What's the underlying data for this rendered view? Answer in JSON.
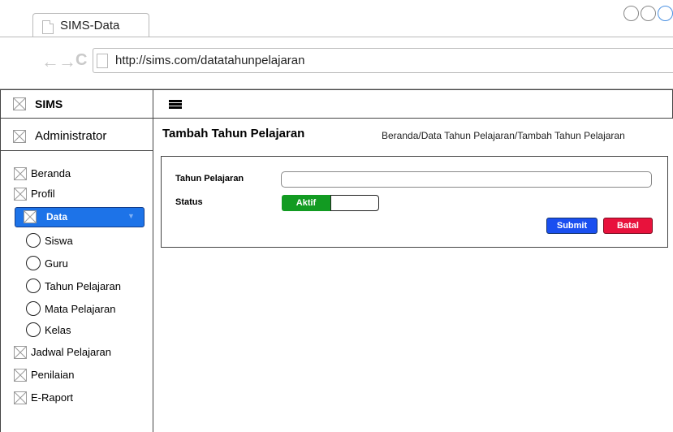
{
  "browser": {
    "tab_title": "SIMS-Data",
    "url": "http://sims.com/datatahunpelajaran"
  },
  "sidebar": {
    "brand": "SIMS",
    "user": "Administrator",
    "items": [
      {
        "label": "Beranda",
        "icon": "image-placeholder-icon"
      },
      {
        "label": "Profil",
        "icon": "image-placeholder-icon"
      },
      {
        "label": "Data",
        "icon": "image-placeholder-icon",
        "selected": true
      },
      {
        "label": "Siswa",
        "icon": "circle-icon"
      },
      {
        "label": "Guru",
        "icon": "circle-icon"
      },
      {
        "label": "Tahun Pelajaran",
        "icon": "circle-icon"
      },
      {
        "label": "Mata Pelajaran",
        "icon": "circle-icon"
      },
      {
        "label": "Kelas",
        "icon": "circle-icon"
      },
      {
        "label": "Jadwal Pelajaran",
        "icon": "image-placeholder-icon"
      },
      {
        "label": "Penilaian",
        "icon": "image-placeholder-icon"
      },
      {
        "label": "E-Raport",
        "icon": "image-placeholder-icon"
      }
    ]
  },
  "main": {
    "title": "Tambah Tahun Pelajaran",
    "breadcrumb": "Beranda/Data Tahun Pelajaran/Tambah Tahun Pelajaran",
    "form": {
      "tahun_label": "Tahun Pelajaran",
      "tahun_value": "",
      "status_label": "Status",
      "status_on_label": "Aktif",
      "submit_label": "Submit",
      "cancel_label": "Batal"
    }
  },
  "colors": {
    "selected_nav": "#1d73e8",
    "toggle_active": "#129b22",
    "submit": "#1a4ff0",
    "cancel": "#e8123c"
  }
}
